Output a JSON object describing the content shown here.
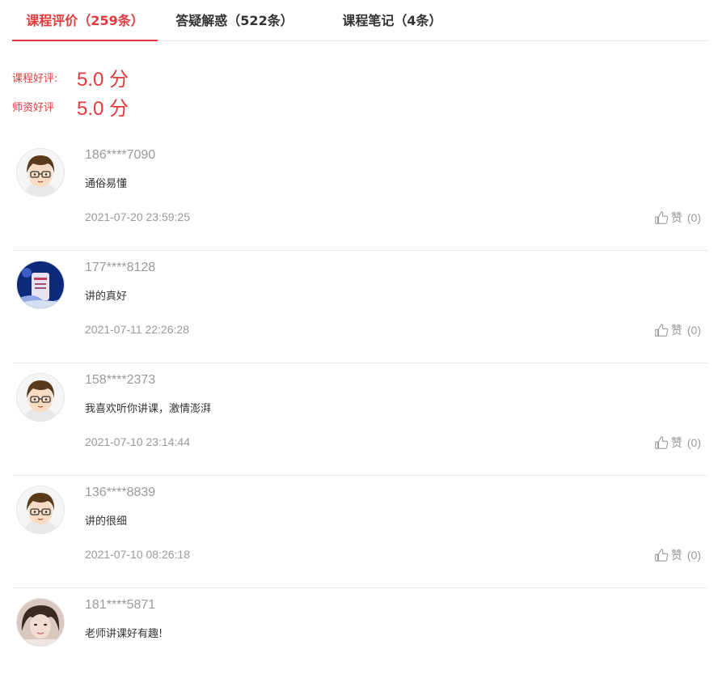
{
  "tabs": [
    {
      "label": "课程评价（259条）",
      "active": true
    },
    {
      "label": "答疑解惑（522条）",
      "active": false
    },
    {
      "label": "课程笔记（4条）",
      "active": false
    }
  ],
  "ratings": [
    {
      "label": "课程好评:",
      "value": "5.0 分"
    },
    {
      "label": "师资好评",
      "value": "5.0 分"
    }
  ],
  "reviews": [
    {
      "user": "186****7090",
      "content": "通俗易懂",
      "time": "2021-07-20 23:59:25",
      "like_label": "赞",
      "like_count": "(0)",
      "avatar": "cartoon-boy"
    },
    {
      "user": "177****8128",
      "content": "讲的真好",
      "time": "2021-07-11 22:26:28",
      "like_label": "赞",
      "like_count": "(0)",
      "avatar": "scenery"
    },
    {
      "user": "158****2373",
      "content": "我喜欢听你讲课，激情澎湃",
      "time": "2021-07-10 23:14:44",
      "like_label": "赞",
      "like_count": "(0)",
      "avatar": "cartoon-boy"
    },
    {
      "user": "136****8839",
      "content": "讲的很细",
      "time": "2021-07-10 08:26:18",
      "like_label": "赞",
      "like_count": "(0)",
      "avatar": "cartoon-boy"
    },
    {
      "user": "181****5871",
      "content": "老师讲课好有趣!",
      "time": "",
      "like_label": "",
      "like_count": "",
      "avatar": "photo-girl"
    }
  ],
  "colors": {
    "accent": "#e4393c",
    "muted": "#999999",
    "divider": "#e8e8e8"
  }
}
